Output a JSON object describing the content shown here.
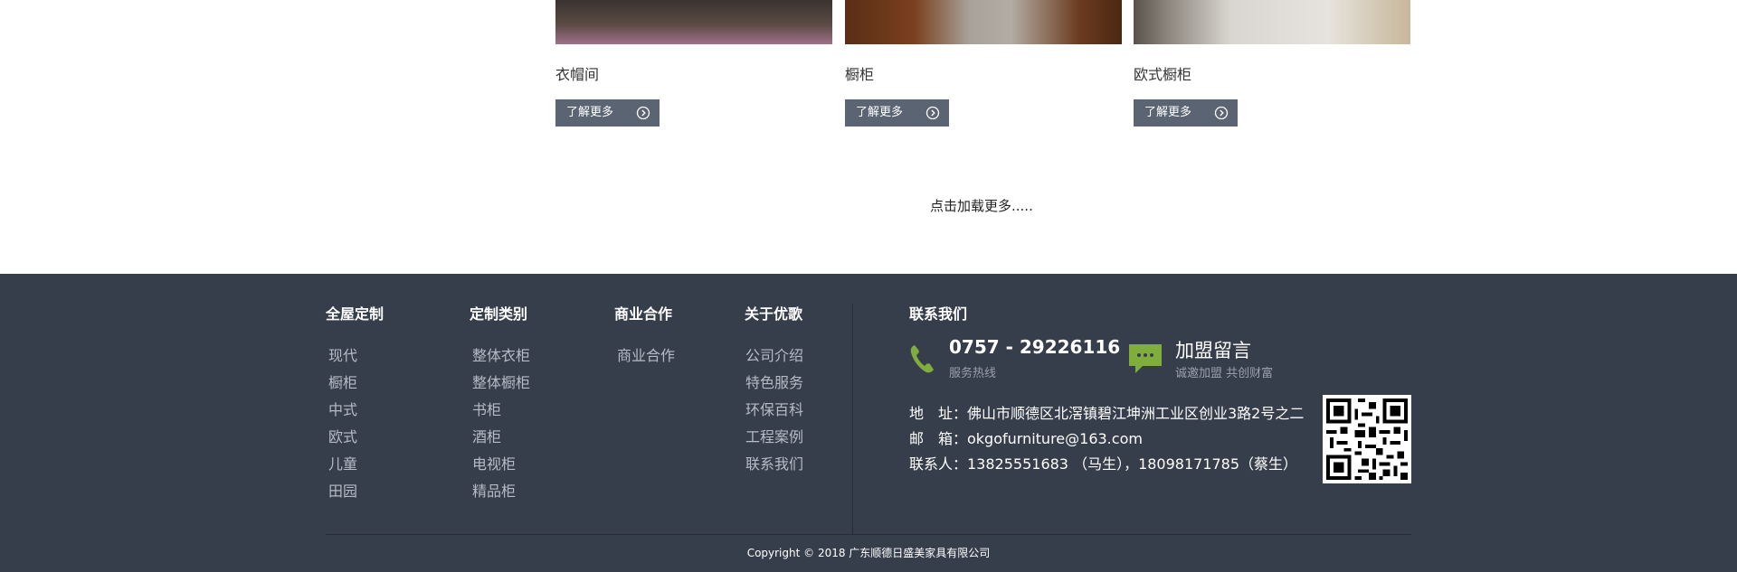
{
  "products": [
    {
      "name": "衣帽间",
      "button": "了解更多"
    },
    {
      "name": "橱柜",
      "button": "了解更多"
    },
    {
      "name": "欧式橱柜",
      "button": "了解更多"
    }
  ],
  "load_more": "点击加载更多.....",
  "footer": {
    "columns": [
      {
        "title": "全屋定制",
        "items": [
          "现代",
          "橱柜",
          "中式",
          "欧式",
          "儿童",
          "田园"
        ]
      },
      {
        "title": "定制类别",
        "items": [
          "整体衣柜",
          "整体橱柜",
          "书柜",
          "酒柜",
          "电视柜",
          "精品柜"
        ]
      },
      {
        "title": "商业合作",
        "items": [
          "商业合作"
        ]
      },
      {
        "title": "关于优歌",
        "items": [
          "公司介绍",
          "特色服务",
          "环保百科",
          "工程案例",
          "联系我们"
        ]
      }
    ],
    "contact": {
      "title": "联系我们",
      "hotline": "0757 - 29226116",
      "hotline_label": "服务热线",
      "join_title": "加盟留言",
      "join_sub": "诚邀加盟 共创财富",
      "address": "地　址：佛山市顺德区北滘镇碧江坤洲工业区创业3路2号之二",
      "email": "邮　箱：okgofurniture@163.com",
      "contact_person": "联系人：13825551683 （马生），18098171785（蔡生）"
    },
    "copyright": "Copyright © 2018 广东顺德日盛美家具有限公司"
  },
  "colors": {
    "footer_bg": "#363d4b",
    "button_bg": "#5b6473",
    "icon_green": "#7fae3d"
  }
}
